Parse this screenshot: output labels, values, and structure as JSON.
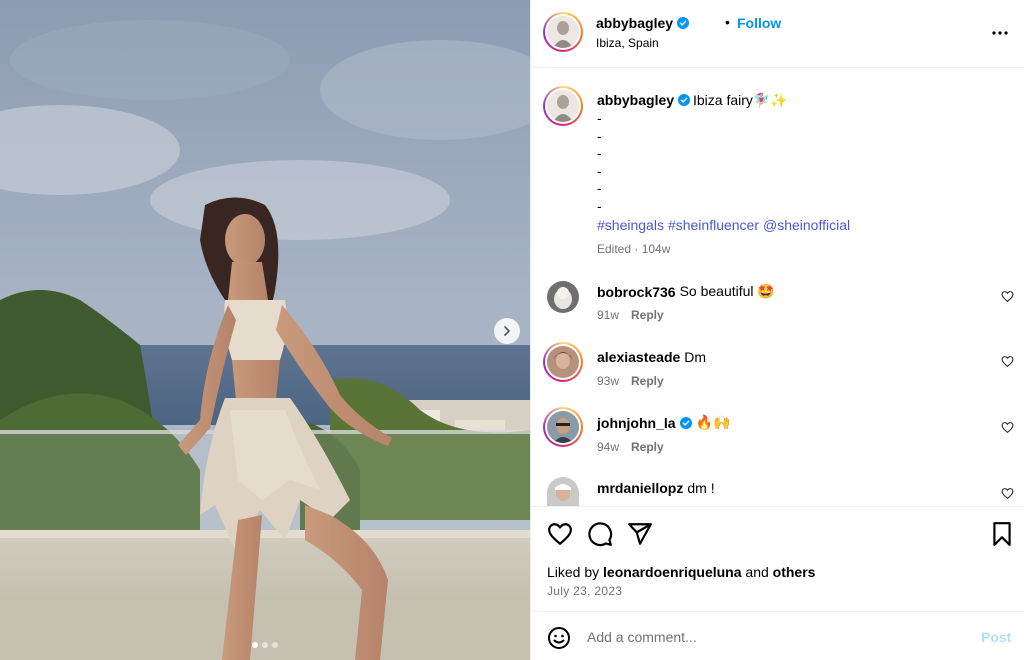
{
  "post": {
    "username": "abbybagley",
    "follow_label": "Follow",
    "separator": "•",
    "location": "Ibiza, Spain"
  },
  "caption": {
    "username": "abbybagley",
    "text": "Ibiza fairy🧚🏼‍♀️✨",
    "dashes": [
      "-",
      "-",
      "-",
      "-",
      "-",
      "-"
    ],
    "hashtags": [
      "#sheingals",
      "#sheinfluencer",
      "@sheinofficial"
    ],
    "meta": "Edited · 104w"
  },
  "comments": [
    {
      "username": "bobrock736",
      "text": "So beautiful 🤩",
      "age": "91w",
      "reply": "Reply",
      "verified": false
    },
    {
      "username": "alexiasteade",
      "text": "Dm",
      "age": "93w",
      "reply": "Reply",
      "verified": false
    },
    {
      "username": "johnjohn_la",
      "text": "🔥🙌",
      "age": "94w",
      "reply": "Reply",
      "verified": true
    },
    {
      "username": "mrdaniellopz",
      "text": "dm !",
      "age": "",
      "reply": "",
      "verified": false
    }
  ],
  "likes": {
    "prefix": "Liked by",
    "user": "leonardoenriqueluna",
    "and": "and",
    "others": "others"
  },
  "date": "July 23, 2023",
  "comment_box": {
    "placeholder": "Add a comment...",
    "post_label": "Post"
  },
  "carousel": {
    "total": 3,
    "active": 0
  },
  "icons": {
    "verified": "verified-badge-icon",
    "more": "more-options-icon",
    "like": "heart-icon",
    "comment": "comment-bubble-icon",
    "share": "paper-plane-icon",
    "save": "bookmark-icon",
    "emoji": "emoji-icon",
    "next": "chevron-right-icon"
  },
  "colors": {
    "link": "#0095f6",
    "hashtag": "#4b57d3",
    "muted": "#737373",
    "post_disabled": "#b2dffc",
    "verified": "#0095f6"
  }
}
